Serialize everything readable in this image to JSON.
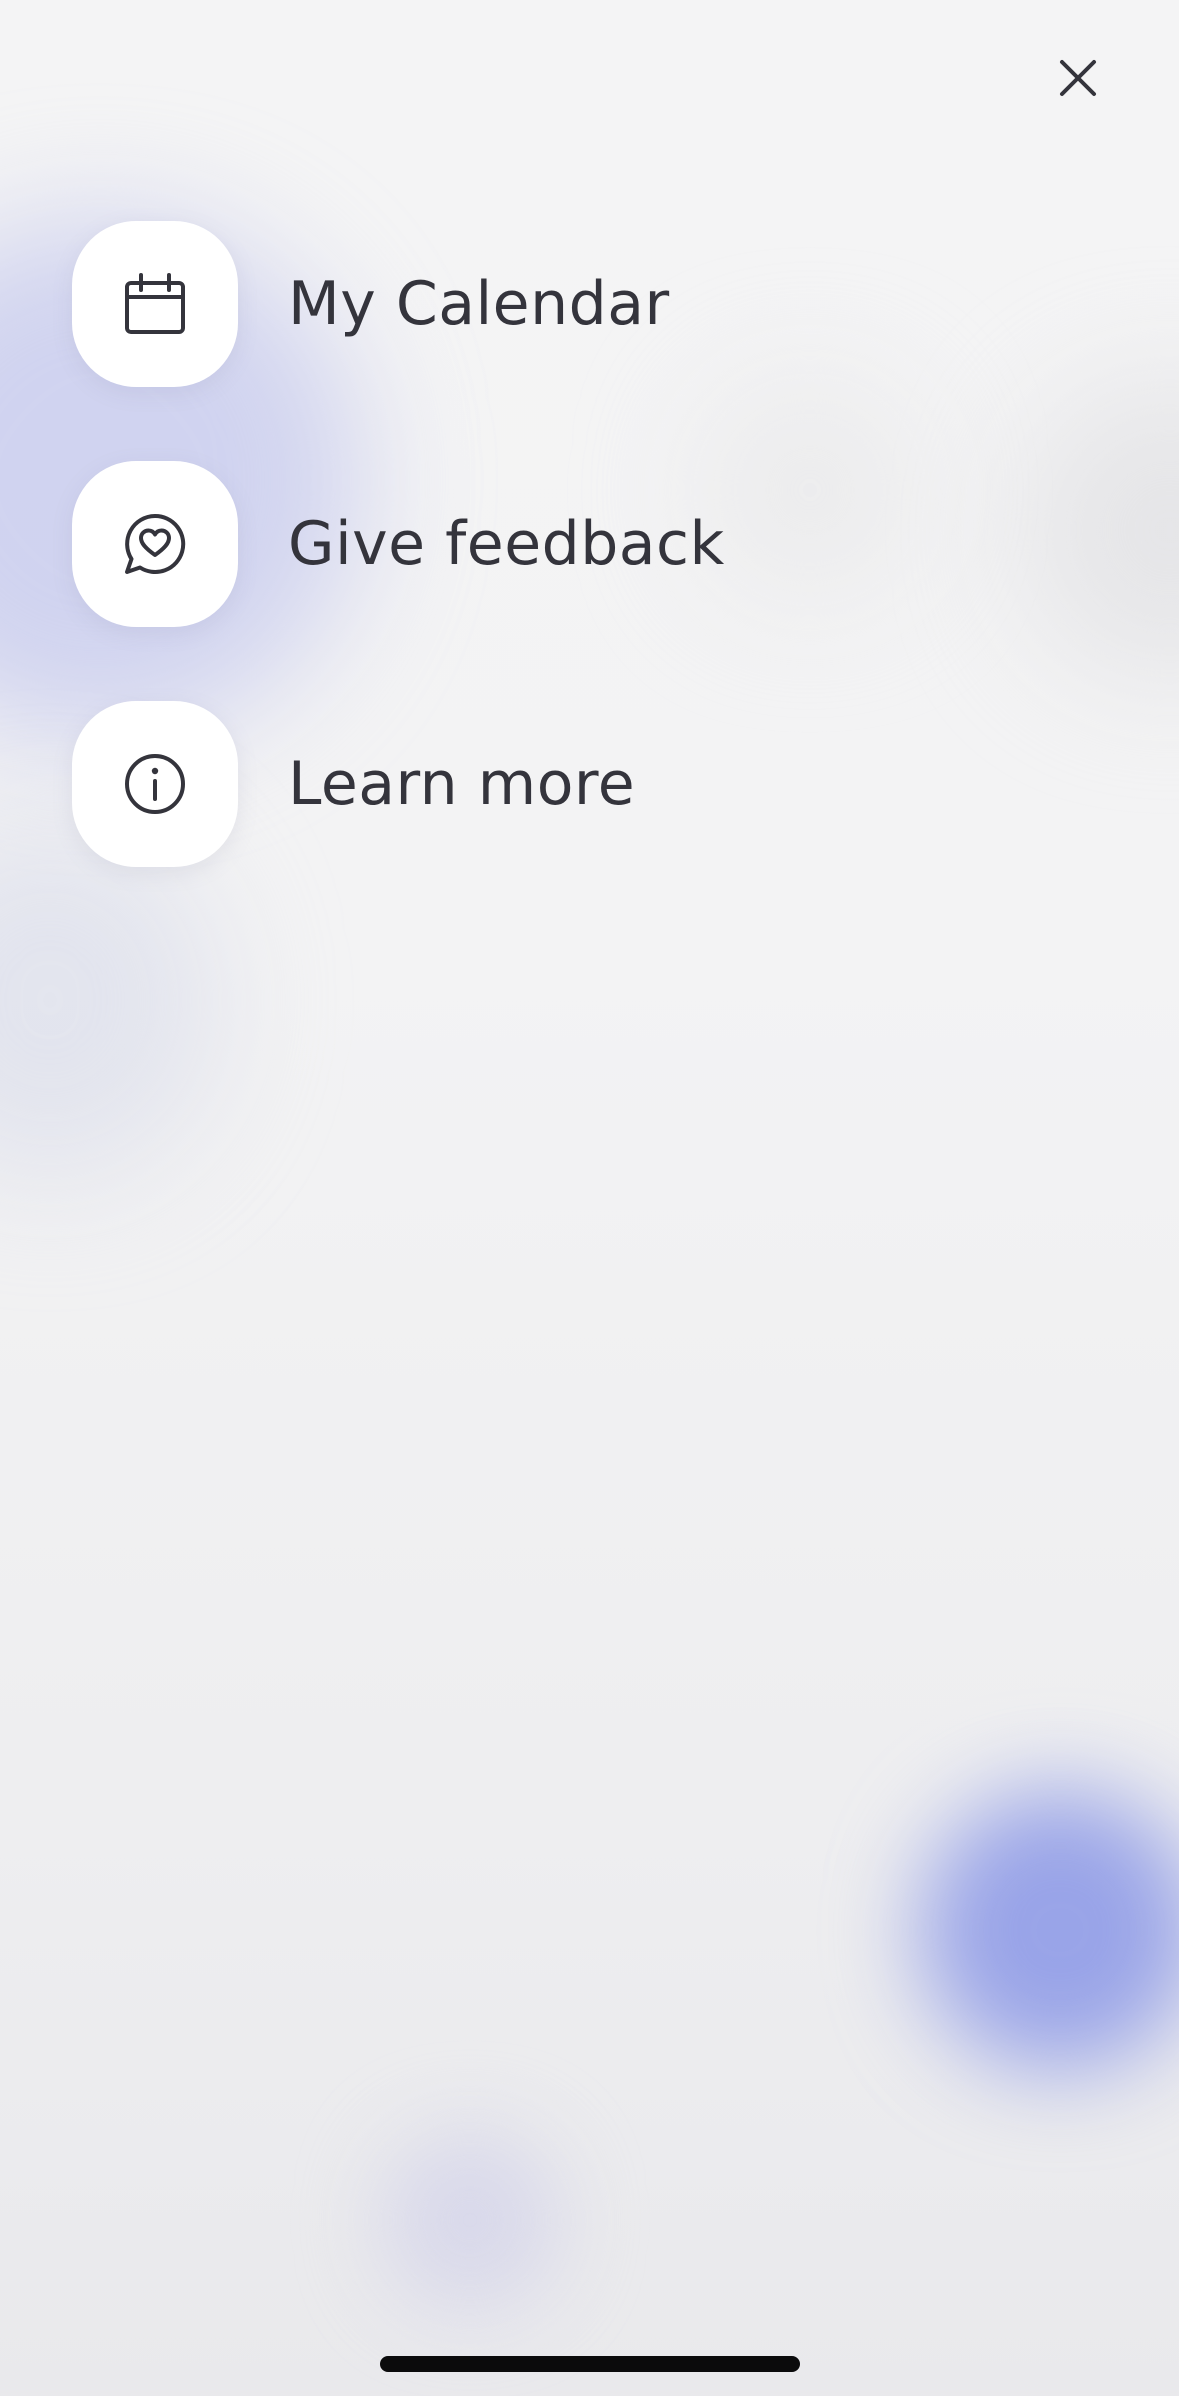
{
  "header": {
    "close_icon": "close-icon"
  },
  "menu": {
    "items": [
      {
        "label": "My Calendar",
        "icon": "calendar-icon"
      },
      {
        "label": "Give feedback",
        "icon": "chat-heart-icon"
      },
      {
        "label": "Learn more",
        "icon": "info-icon"
      }
    ]
  },
  "colors": {
    "text": "#34343c",
    "tile": "#ffffff",
    "accent_blob": "#8a96e6"
  }
}
